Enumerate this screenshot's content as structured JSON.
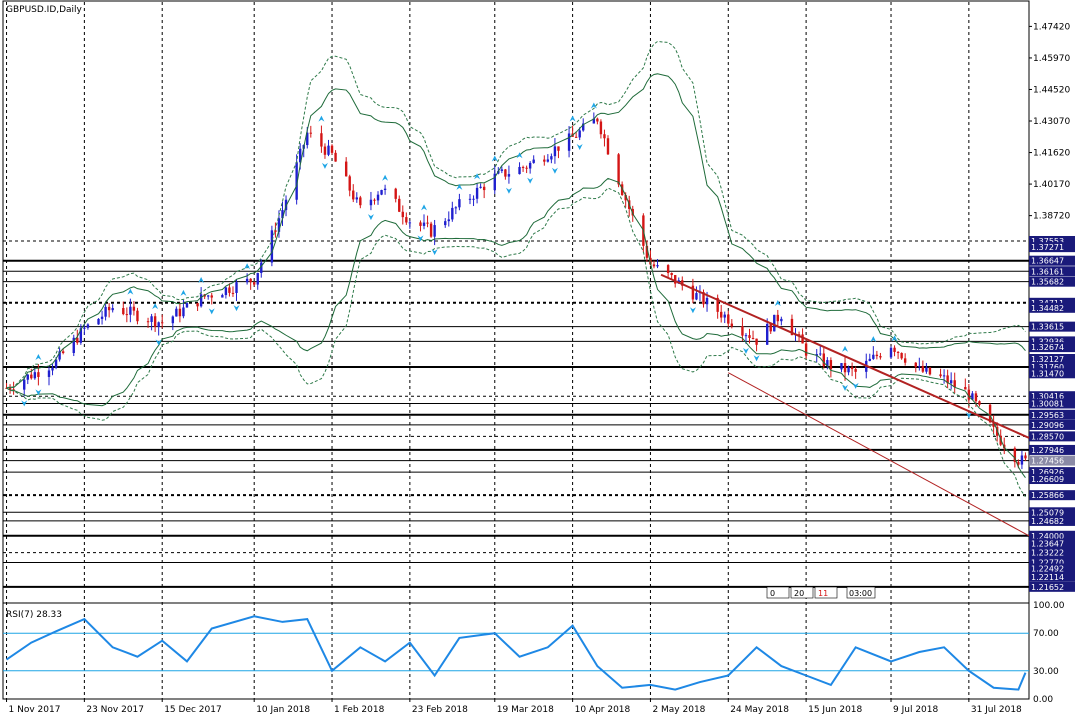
{
  "window": {
    "title": "GBPUSD.ID,Daily"
  },
  "colors": {
    "background": "#ffffff",
    "grid": "#000000",
    "bull_candle": "#1f1fcf",
    "bear_candle": "#d41515",
    "bands_outer": "#1f6b3a",
    "bands_dashed": "#2f7a4a",
    "trendline": "#b22222",
    "fractal": "#1ea5e6",
    "rsi_line": "#1e88e5",
    "rsi_level": "#1ea5e6",
    "tag_bg": "#1a1a7a",
    "tag_text": "#ffffff"
  },
  "price_axis": {
    "labels": [
      "1.47420",
      "1.45970",
      "1.44520",
      "1.43070",
      "1.41620",
      "1.40170",
      "1.38720"
    ],
    "tags": [
      "1.37553",
      "1.37271",
      "1.36647",
      "1.36161",
      "1.35682",
      "1.34711",
      "1.34482",
      "1.33615",
      "1.32936",
      "1.32674",
      "1.32127",
      "1.31760",
      "1.31470",
      "1.30416",
      "1.30081",
      "1.29563",
      "1.29096",
      "1.28570",
      "1.27946",
      "1.27456",
      "1.26926",
      "1.26609",
      "1.25866",
      "1.25079",
      "1.24682",
      "1.24000",
      "1.23647",
      "1.23222",
      "1.22770",
      "1.22492",
      "1.22114",
      "1.21652"
    ]
  },
  "date_axis": {
    "labels": [
      "1 Nov 2017",
      "23 Nov 2017",
      "15 Dec 2017",
      "10 Jan 2018",
      "1 Feb 2018",
      "23 Feb 2018",
      "19 Mar 2018",
      "10 Apr 2018",
      "2 May 2018",
      "24 May 2018",
      "15 Jun 2018",
      "9 Jul 2018",
      "31 Jul 2018"
    ]
  },
  "info_box": {
    "cells": [
      "0",
      "20",
      "11"
    ],
    "time": "03:00"
  },
  "rsi": {
    "title": "RSI(7) 28.33",
    "levels_labels": [
      "100.00",
      "70.00",
      "30.00",
      "0.00"
    ]
  },
  "chart_data": [
    {
      "type": "candlestick",
      "symbol": "GBPUSD.ID",
      "timeframe": "Daily",
      "x_range": [
        "1 Nov 2017",
        "16 Aug 2018"
      ],
      "ylim": [
        1.21,
        1.4845
      ],
      "grid": true,
      "overlays": [
        "bollinger-style bands",
        "fractals",
        "descending trendlines"
      ],
      "close_path": {
        "dates": [
          "1 Nov 2017",
          "15 Nov 2017",
          "23 Nov 2017",
          "1 Dec 2017",
          "15 Dec 2017",
          "27 Dec 2017",
          "10 Jan 2018",
          "18 Jan 2018",
          "25 Jan 2018",
          "1 Feb 2018",
          "9 Feb 2018",
          "15 Feb 2018",
          "23 Feb 2018",
          "1 Mar 2018",
          "9 Mar 2018",
          "19 Mar 2018",
          "28 Mar 2018",
          "10 Apr 2018",
          "17 Apr 2018",
          "24 Apr 2018",
          "2 May 2018",
          "11 May 2018",
          "24 May 2018",
          "1 Jun 2018",
          "8 Jun 2018",
          "15 Jun 2018",
          "22 Jun 2018",
          "29 Jun 2018",
          "9 Jul 2018",
          "17 Jul 2018",
          "24 Jul 2018",
          "31 Jul 2018",
          "7 Aug 2018",
          "14 Aug 2018",
          "16 Aug 2018"
        ],
        "values": [
          1.308,
          1.32,
          1.335,
          1.345,
          1.338,
          1.35,
          1.358,
          1.39,
          1.425,
          1.415,
          1.39,
          1.4,
          1.385,
          1.38,
          1.392,
          1.405,
          1.41,
          1.423,
          1.432,
          1.399,
          1.365,
          1.355,
          1.34,
          1.33,
          1.342,
          1.325,
          1.318,
          1.315,
          1.328,
          1.316,
          1.312,
          1.305,
          1.288,
          1.275,
          1.274
        ]
      },
      "trendlines": [
        {
          "from": [
            "5 May 2018",
            1.36
          ],
          "to": [
            "17 Aug 2018",
            1.285
          ]
        },
        {
          "from": [
            "24 May 2018",
            1.315
          ],
          "to": [
            "17 Aug 2018",
            1.24
          ]
        }
      ],
      "horizontal_levels": [
        1.37553,
        1.36647,
        1.36161,
        1.35682,
        1.34711,
        1.33615,
        1.32936,
        1.3176,
        1.30416,
        1.30081,
        1.29563,
        1.29096,
        1.2857,
        1.27946,
        1.27456,
        1.26926,
        1.25866,
        1.25079,
        1.24682,
        1.24,
        1.23222,
        1.2277,
        1.21652
      ]
    },
    {
      "type": "line",
      "title": "RSI(7) 28.33",
      "ylim": [
        0,
        100
      ],
      "levels": [
        70,
        30
      ],
      "series": [
        {
          "dates": [
            "1 Nov 2017",
            "8 Nov 2017",
            "15 Nov 2017",
            "23 Nov 2017",
            "1 Dec 2017",
            "8 Dec 2017",
            "15 Dec 2017",
            "22 Dec 2017",
            "29 Dec 2017",
            "10 Jan 2018",
            "18 Jan 2018",
            "25 Jan 2018",
            "1 Feb 2018",
            "9 Feb 2018",
            "16 Feb 2018",
            "23 Feb 2018",
            "2 Mar 2018",
            "9 Mar 2018",
            "19 Mar 2018",
            "26 Mar 2018",
            "3 Apr 2018",
            "10 Apr 2018",
            "17 Apr 2018",
            "24 Apr 2018",
            "2 May 2018",
            "9 May 2018",
            "16 May 2018",
            "24 May 2018",
            "1 Jun 2018",
            "8 Jun 2018",
            "15 Jun 2018",
            "22 Jun 2018",
            "29 Jun 2018",
            "9 Jul 2018",
            "17 Jul 2018",
            "24 Jul 2018",
            "31 Jul 2018",
            "7 Aug 2018",
            "14 Aug 2018",
            "16 Aug 2018"
          ],
          "values": [
            42,
            60,
            72,
            85,
            55,
            45,
            62,
            40,
            75,
            88,
            82,
            85,
            30,
            55,
            40,
            60,
            25,
            65,
            70,
            45,
            55,
            78,
            35,
            12,
            15,
            10,
            18,
            25,
            55,
            35,
            25,
            15,
            55,
            40,
            50,
            55,
            30,
            12,
            10,
            28
          ]
        }
      ]
    }
  ]
}
